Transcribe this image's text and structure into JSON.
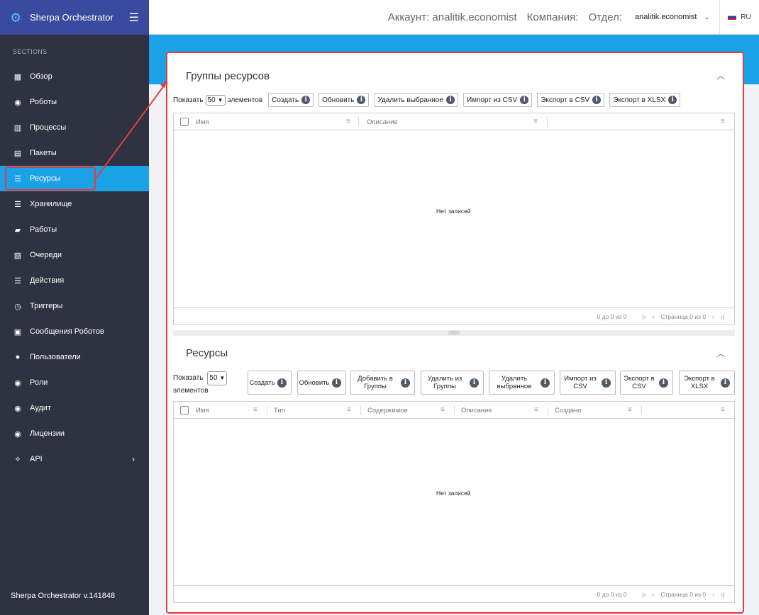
{
  "app": {
    "title": "Sherpa Orchestrator",
    "version": "Sherpa Orchestrator v.141848"
  },
  "sidebar": {
    "section_label": "SECTIONS",
    "items": [
      {
        "label": "Обзор",
        "icon": "dashboard-icon"
      },
      {
        "label": "Роботы",
        "icon": "robot-icon"
      },
      {
        "label": "Процессы",
        "icon": "process-icon"
      },
      {
        "label": "Пакеты",
        "icon": "package-icon"
      },
      {
        "label": "Ресурсы",
        "icon": "list-icon",
        "active": true
      },
      {
        "label": "Хранилище",
        "icon": "list-icon"
      },
      {
        "label": "Работы",
        "icon": "briefcase-icon"
      },
      {
        "label": "Очереди",
        "icon": "queue-icon"
      },
      {
        "label": "Действия",
        "icon": "list-icon"
      },
      {
        "label": "Триггеры",
        "icon": "clock-icon"
      },
      {
        "label": "Сообщения Роботов",
        "icon": "message-icon"
      },
      {
        "label": "Пользователи",
        "icon": "user-icon"
      },
      {
        "label": "Роли",
        "icon": "role-icon"
      },
      {
        "label": "Аудит",
        "icon": "audit-icon"
      },
      {
        "label": "Лицензии",
        "icon": "license-icon"
      },
      {
        "label": "API",
        "icon": "api-icon"
      }
    ]
  },
  "header": {
    "account": "Аккаунт: analitik.economist",
    "company": "Компания:",
    "department": "Отдел:",
    "user": "analitik.economist",
    "lang": "RU"
  },
  "groups": {
    "title": "Группы ресурсов",
    "show_label": "Показать",
    "page_size": "50",
    "items_label": "элементов",
    "buttons": [
      "Создать",
      "Обновить",
      "Удалить выбранное",
      "Импорт из CSV",
      "Экспорт в CSV",
      "Экспорт в XLSX"
    ],
    "columns": [
      "Имя",
      "Описание"
    ],
    "empty": "Нет записей",
    "footer": {
      "range": "0 до 0 из 0",
      "page": "Страница 0 из 0"
    }
  },
  "resources": {
    "title": "Ресурсы",
    "show_label": "Показать",
    "page_size": "50",
    "items_label": "элементов",
    "buttons": [
      "Создать",
      "Обновить",
      "Добавить в Группы",
      "Удалить из Группы",
      "Удалить выбранное",
      "Импорт из CSV",
      "Экспорт в CSV",
      "Экспорт в XLSX"
    ],
    "columns": [
      "Имя",
      "Тип",
      "Содержимое",
      "Описание",
      "Создано"
    ],
    "empty": "Нет записей",
    "footer": {
      "range": "0 до 0 из 0",
      "page": "Страница 0 из 0"
    }
  },
  "colors": {
    "sidebar": "#2f3241",
    "brand": "#3a4a9f",
    "accent": "#1aa1e6",
    "highlight": "#e0403d"
  }
}
